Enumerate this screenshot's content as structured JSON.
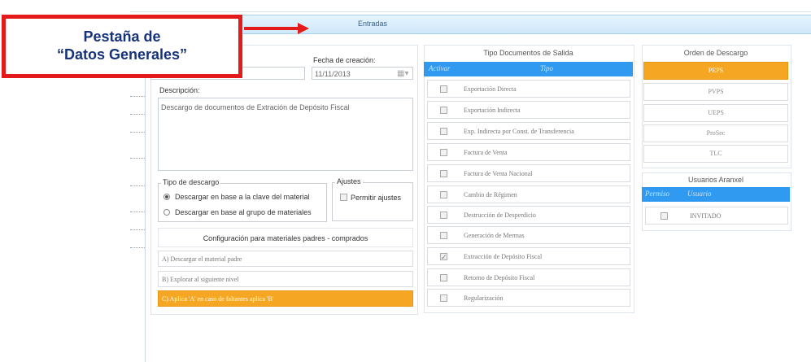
{
  "callout": {
    "line1": "Pestaña de",
    "line2": "“Datos Generales”"
  },
  "tab": {
    "label": "Entradas"
  },
  "general": {
    "fecha_label": "Fecha de creación:",
    "fecha_value": "11/11/2013",
    "descripcion_label": "Descripción:",
    "descripcion_value": "Descargo de documentos de Extración de Depósito Fiscal",
    "tipo_descargo_label": "Tipo de descargo",
    "radio_clave": "Descargar en base a la clave del material",
    "radio_grupo": "Descargar en base al grupo de materiales",
    "ajustes_label": "Ajustes",
    "permitir_ajustes": "Permitir ajustes",
    "config_title": "Configuración para materiales padres - comprados",
    "config_options": [
      "A) Descargar el material padre",
      "B) Explorar al siguiente nivel",
      "C) Aplica 'A' en caso de faltantes aplica 'B'"
    ],
    "config_selected_index": 2
  },
  "tipo_docs": {
    "title": "Tipo Documentos de Salida",
    "col_activar": "Activar",
    "col_tipo": "Tipo",
    "rows": [
      {
        "label": "Exportación Directa",
        "checked": false
      },
      {
        "label": "Exportación Indirecta",
        "checked": false
      },
      {
        "label": "Exp. Indirecta por Const. de Transferencia",
        "checked": false
      },
      {
        "label": "Factura de Venta",
        "checked": false
      },
      {
        "label": "Factura de Venta Nacional",
        "checked": false
      },
      {
        "label": "Cambio de Régimen",
        "checked": false
      },
      {
        "label": "Destrucción de Desperdicio",
        "checked": false
      },
      {
        "label": "Generación de Mermas",
        "checked": false
      },
      {
        "label": "Extracción de Depósito Fiscal",
        "checked": true
      },
      {
        "label": "Retorno de Depósito Fiscal",
        "checked": false
      },
      {
        "label": "Regularización",
        "checked": false
      }
    ]
  },
  "orden": {
    "title": "Orden de Descargo",
    "options": [
      "PEPS",
      "PVPS",
      "UEPS",
      "ProSec",
      "TLC"
    ],
    "selected_index": 0
  },
  "usuarios": {
    "title": "Usuarios Aranxel",
    "col_permiso": "Permiso",
    "col_usuario": "Usuario",
    "rows": [
      {
        "label": "INVITADO",
        "checked": false
      }
    ]
  },
  "colors": {
    "accent_orange": "#f5a623",
    "grid_blue": "#2f9af0",
    "callout_red": "#e31b1b",
    "callout_text": "#16327a"
  }
}
